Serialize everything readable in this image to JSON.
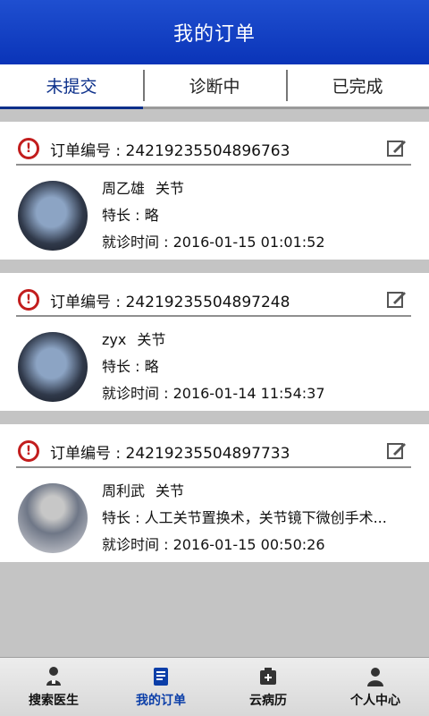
{
  "header": {
    "title": "我的订单"
  },
  "tabs": [
    {
      "label": "未提交"
    },
    {
      "label": "诊断中"
    },
    {
      "label": "已完成"
    }
  ],
  "orders": [
    {
      "order_label": "订单编号",
      "order_no": "24219235504896763",
      "doctor": "周乙雄",
      "department": "关节",
      "specialty_label": "特长",
      "specialty": "略",
      "time_label": "就诊时间",
      "time": "2016-01-15 01:01:52"
    },
    {
      "order_label": "订单编号",
      "order_no": "24219235504897248",
      "doctor": "zyx",
      "department": "关节",
      "specialty_label": "特长",
      "specialty": "略",
      "time_label": "就诊时间",
      "time": "2016-01-14 11:54:37"
    },
    {
      "order_label": "订单编号",
      "order_no": "24219235504897733",
      "doctor": "周利武",
      "department": "关节",
      "specialty_label": "特长",
      "specialty": "人工关节置换术，关节镜下微创手术...",
      "time_label": "就诊时间",
      "time": "2016-01-15 00:50:26"
    }
  ],
  "bottom_nav": [
    {
      "label": "搜索医生",
      "icon": "doctor-icon"
    },
    {
      "label": "我的订单",
      "icon": "order-icon"
    },
    {
      "label": "云病历",
      "icon": "record-icon"
    },
    {
      "label": "个人中心",
      "icon": "user-icon"
    }
  ],
  "colors": {
    "header": "#0a34b8",
    "active_tab": "#0b2f8a",
    "alert": "#c21d1d",
    "nav_active": "#0b3ea8"
  }
}
